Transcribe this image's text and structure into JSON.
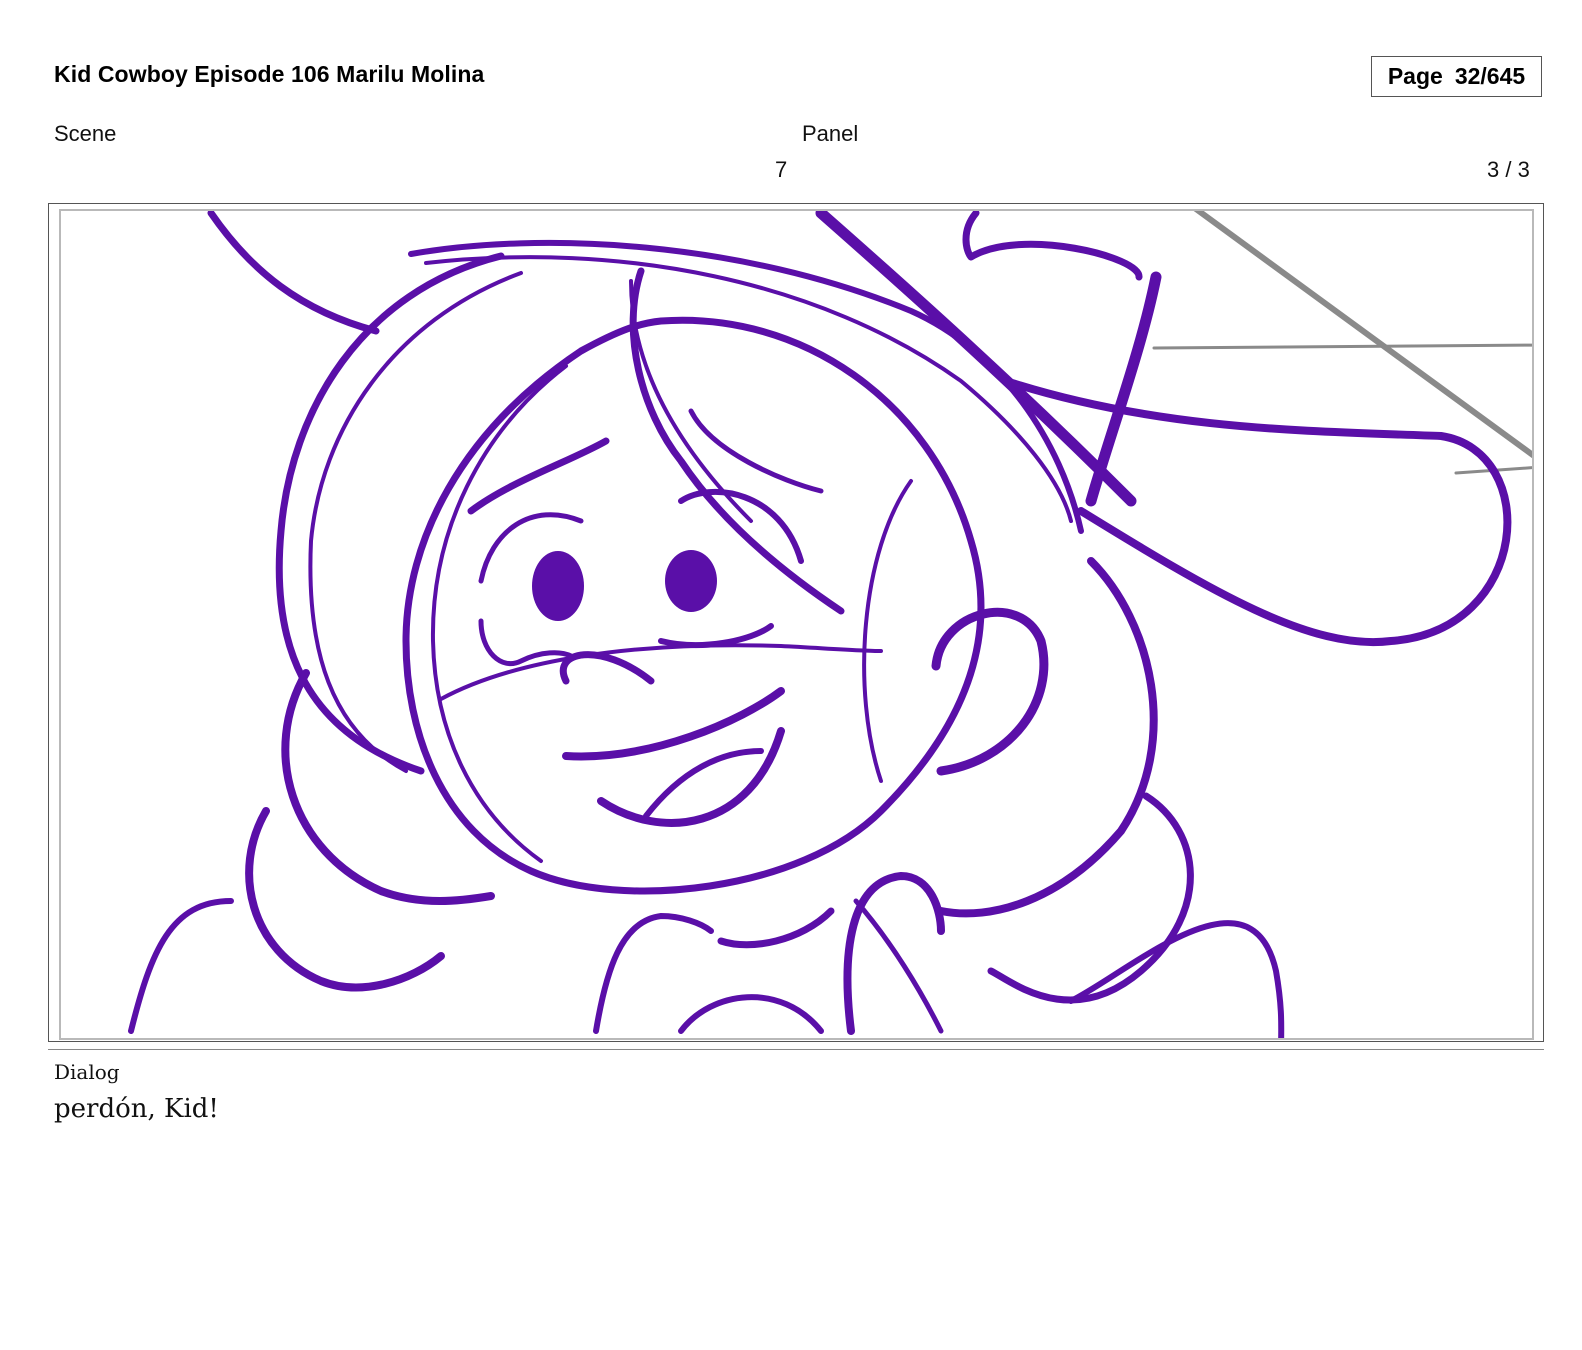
{
  "header": {
    "title": "Kid Cowboy Episode 106 Marilu Molina",
    "page_label": "Page",
    "page_value": "32/645"
  },
  "labels": {
    "scene": "Scene",
    "panel": "Panel"
  },
  "values": {
    "scene": "7",
    "panel": "3 / 3"
  },
  "drawing": {
    "ink_color": "#5a0fa8",
    "guide_color": "#8a8a8a",
    "subject": "storyboard-sketch"
  },
  "dialog": {
    "label": "Dialog",
    "text": "perdón, Kid!"
  }
}
